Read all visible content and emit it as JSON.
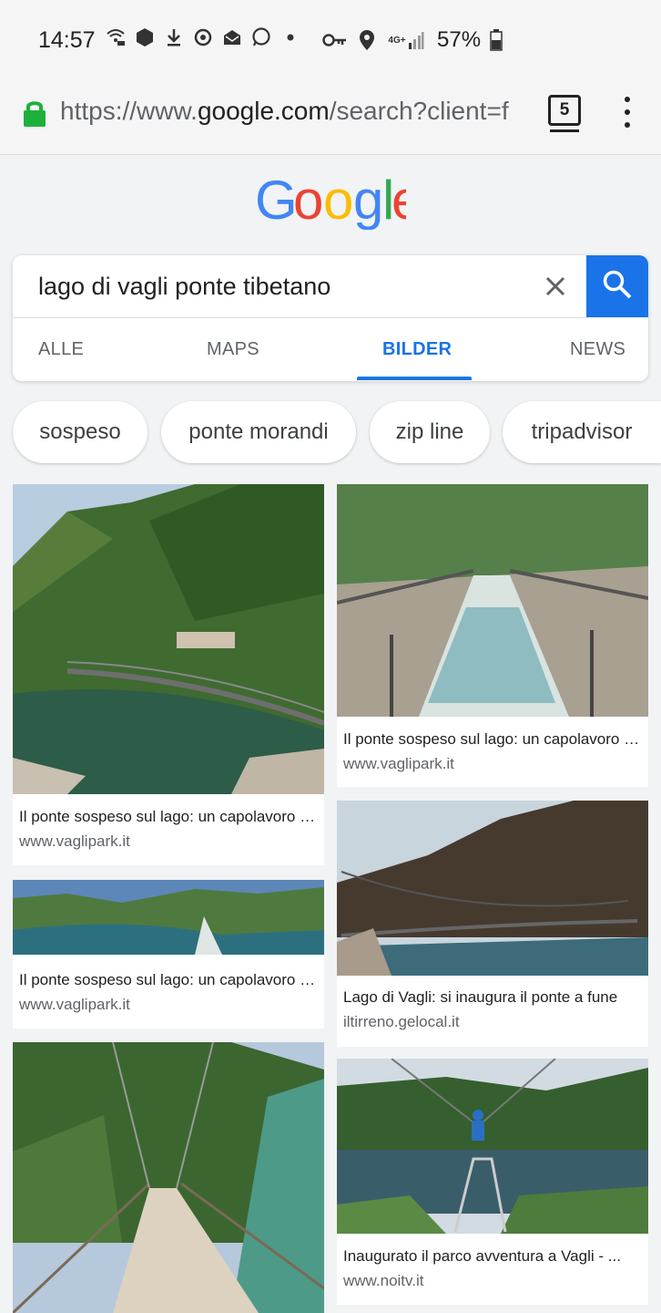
{
  "status_bar": {
    "time": "14:57",
    "network": "4G+",
    "battery": "57%",
    "icons": [
      "wifi-calling-icon",
      "vpn-hex-icon",
      "download-icon",
      "sync-icon",
      "mail-icon",
      "whatsapp-icon",
      "dot-icon",
      "key-icon",
      "location-icon",
      "signal-icon",
      "battery-icon"
    ]
  },
  "url_bar": {
    "scheme": "https://www.",
    "domain": "google.com",
    "path": "/search?client=f",
    "tab_count": "5"
  },
  "search": {
    "query": "lago di vagli ponte tibetano",
    "tabs": [
      {
        "label": "ALLE"
      },
      {
        "label": "MAPS"
      },
      {
        "label": "BILDER"
      },
      {
        "label": "NEWS"
      }
    ]
  },
  "chips": [
    {
      "label": "sospeso"
    },
    {
      "label": "ponte morandi"
    },
    {
      "label": "zip line"
    },
    {
      "label": "tripadvisor"
    }
  ],
  "results": [
    {
      "title": "Il ponte sospeso sul lago: un capolavoro di ingegneria",
      "source": "www.vaglipark.it"
    },
    {
      "title": "Il ponte sospeso sul lago: un capolavoro di ingegneria",
      "source": "www.vaglipark.it"
    },
    {
      "title": "Il ponte sospeso sul lago: un capolavoro di ingegneria",
      "source": "www.vaglipark.it"
    },
    {
      "title": "Lago di Vagli: si inaugura il ponte a fune",
      "source": "iltirreno.gelocal.it"
    },
    {
      "title": "Inaugurato il parco avventura a Vagli - ...",
      "source": "www.noitv.it"
    },
    {
      "title": "",
      "source": ""
    }
  ],
  "colors": {
    "accent": "#1a73e8",
    "lock": "#1db13b"
  }
}
